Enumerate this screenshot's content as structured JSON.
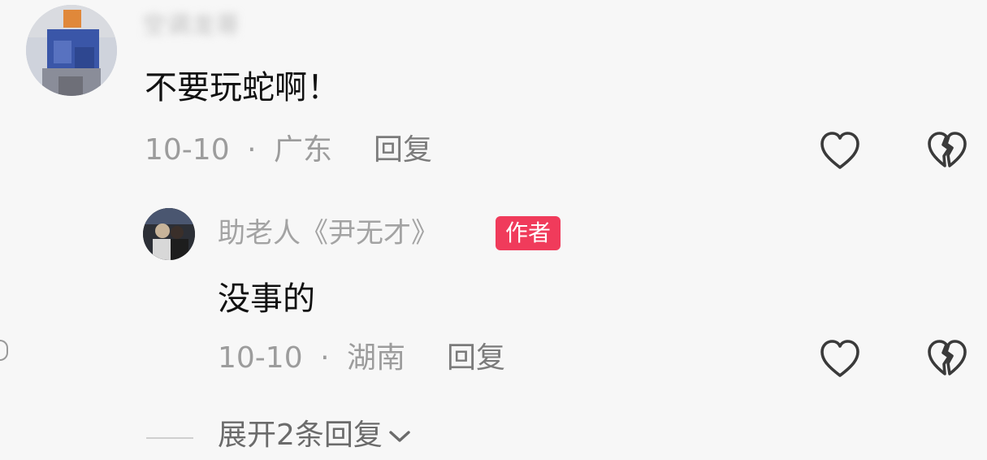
{
  "comment": {
    "username": "空调龙哥",
    "text": "不要玩蛇啊！",
    "date": "10-10",
    "location": "广东",
    "separator": "·",
    "reply_label": "回复"
  },
  "reply": {
    "username": "助老人《尹无才》",
    "badge": "作者",
    "text": "没事的",
    "date": "10-10",
    "location": "湖南",
    "separator": "·",
    "reply_label": "回复"
  },
  "expand": {
    "label": "展开2条回复"
  },
  "icons": {
    "like": "heart-outline-icon",
    "dislike": "broken-heart-icon",
    "expand": "chevron-down-icon"
  },
  "colors": {
    "badge": "#f03b5b",
    "meta": "#9c9c9c",
    "text": "#111111"
  }
}
